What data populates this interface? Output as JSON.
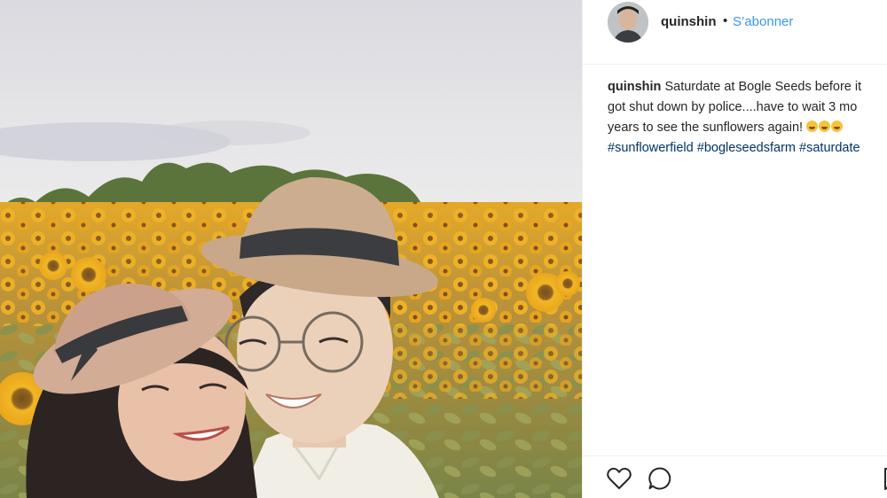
{
  "post": {
    "username": "quinshin",
    "separator": "•",
    "follow_label": "S’abonner",
    "caption": {
      "username": "quinshin",
      "line1": "Saturdate at Bogle Seeds before it",
      "line2": "got shut down by police....have to wait 3 mo",
      "line3": "years to see the sunflowers again!",
      "hashtags": [
        "#sunflowerfield",
        "#bogleseedsfarm",
        "#saturdate"
      ]
    },
    "actions": {
      "like_icon": "heart-icon",
      "comment_icon": "comment-icon",
      "save_icon": "bookmark-icon"
    }
  },
  "colors": {
    "link_blue": "#3897f0",
    "hashtag_navy": "#003569",
    "text": "#262626",
    "divider": "#efefef"
  }
}
